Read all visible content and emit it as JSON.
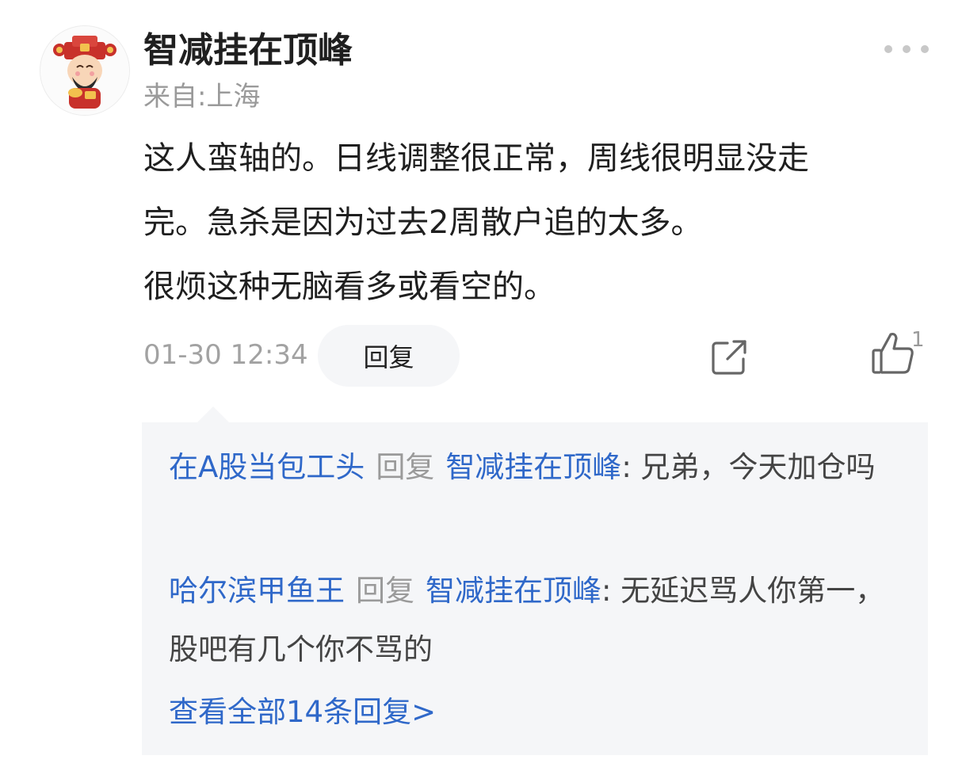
{
  "post": {
    "username": "智减挂在顶峰",
    "location": "来自:上海",
    "content_lines": [
      "这人蛮轴的。日线调整很正常，周线很明显没走",
      "完。急杀是因为过去2周散户追的太多。",
      "很烦这种无脑看多或看空的。"
    ],
    "timestamp": "01-30 12:34",
    "reply_label": "回复",
    "like_count": "1"
  },
  "replies": [
    {
      "author": "在A股当包工头",
      "verb": "回复",
      "target": "智减挂在顶峰",
      "text": ": 兄弟，今天加仓吗"
    },
    {
      "author": "哈尔滨甲鱼王",
      "verb": "回复",
      "target": "智减挂在顶峰",
      "text": ": 无延迟骂人你第一，股吧有几个你不骂的"
    }
  ],
  "view_all_label": "查看全部14条回复>",
  "colors": {
    "link_blue": "#2f68c9",
    "muted_gray": "#9a9a9a",
    "reply_bg": "#f5f6f8"
  },
  "icons": {
    "more": "more-dots-icon",
    "share": "share-icon",
    "like": "thumbs-up-icon",
    "avatar": "avatar-image"
  }
}
